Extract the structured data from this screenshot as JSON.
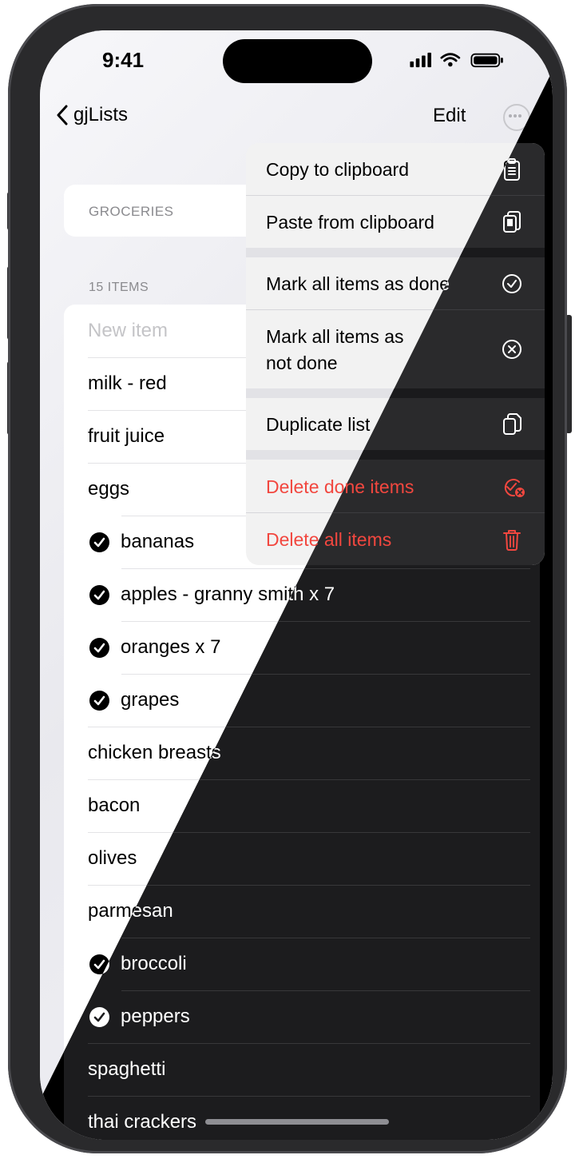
{
  "status_bar": {
    "time": "9:41"
  },
  "nav": {
    "back_label": "gjLists",
    "edit_label": "Edit"
  },
  "list": {
    "title": "GROCERIES",
    "count_label": "15 ITEMS",
    "new_item_placeholder": "New item",
    "items": [
      {
        "text": "milk - red",
        "done": false
      },
      {
        "text": "fruit juice",
        "done": false
      },
      {
        "text": "eggs",
        "done": false
      },
      {
        "text": "bananas",
        "done": true
      },
      {
        "text": "apples - granny smith x 7",
        "done": true
      },
      {
        "text": "oranges x 7",
        "done": true
      },
      {
        "text": "grapes",
        "done": true
      },
      {
        "text": "chicken breasts",
        "done": false
      },
      {
        "text": "bacon",
        "done": false
      },
      {
        "text": "olives",
        "done": false
      },
      {
        "text": "parmesan",
        "done": false
      },
      {
        "text": "broccoli",
        "done": true
      },
      {
        "text": "peppers",
        "done": true
      },
      {
        "text": "spaghetti",
        "done": false
      },
      {
        "text": "thai crackers",
        "done": false
      }
    ]
  },
  "menu": {
    "copy": "Copy to clipboard",
    "paste": "Paste from clipboard",
    "mark_done": "Mark all items as done",
    "mark_not_done_line1": "Mark all items as",
    "mark_not_done_line2": "not done",
    "duplicate": "Duplicate list",
    "delete_done": "Delete done items",
    "delete_all": "Delete all items"
  },
  "colors": {
    "destructive": "#f2473f",
    "light_text": "#000000",
    "dark_text": "#ffffff",
    "placeholder_light": "#c4c4c7",
    "placeholder_dark": "#5a5a5e"
  }
}
